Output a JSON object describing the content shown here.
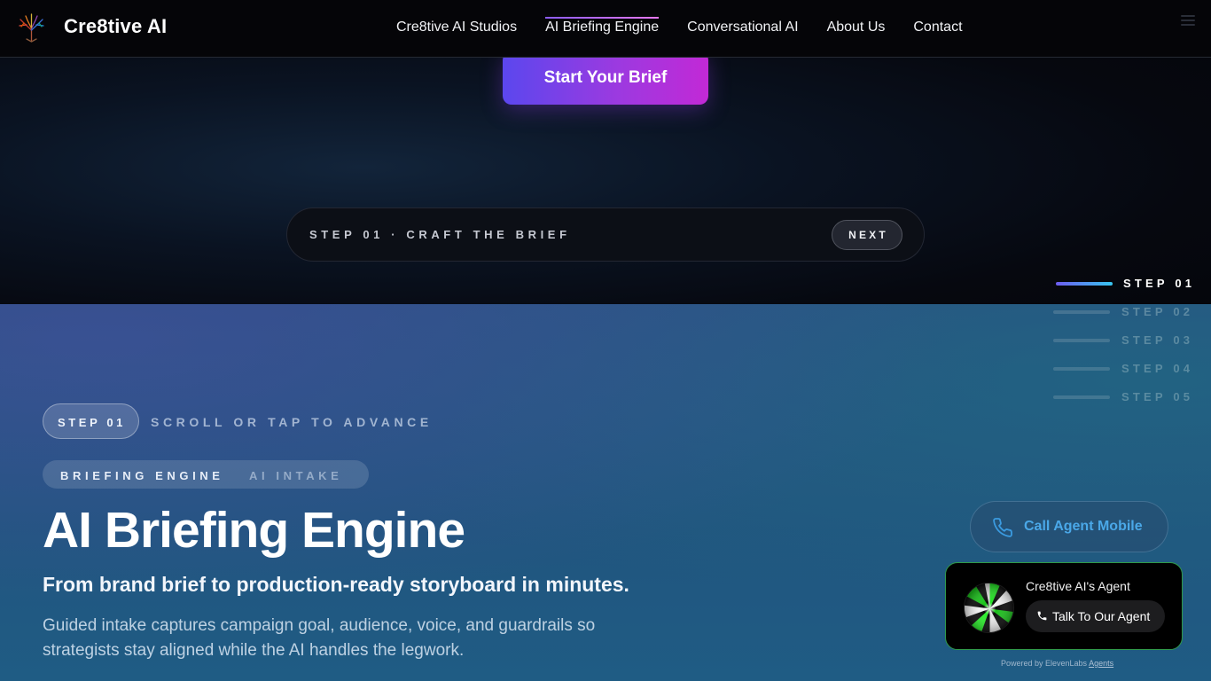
{
  "nav": {
    "brand": "Cre8tive AI",
    "links": [
      "Cre8tive AI Studios",
      "AI Briefing Engine",
      "Conversational AI",
      "About Us",
      "Contact"
    ],
    "active_link": "AI Briefing Engine",
    "menu_icon": "hamburger-icon"
  },
  "hero": {
    "cta_label": "Start Your Brief",
    "step_bar_label": "STEP 01 · CRAFT THE BRIEF",
    "next_label": "NEXT"
  },
  "step_nav": {
    "items": [
      "STEP 01",
      "STEP 02",
      "STEP 03",
      "STEP 04",
      "STEP 05"
    ],
    "active_index": 0
  },
  "section": {
    "step_pill": "STEP 01",
    "scroll_hint": "SCROLL OR TAP TO ADVANCE",
    "eyebrow_primary": "BRIEFING ENGINE",
    "eyebrow_secondary": "AI INTAKE",
    "title": "AI Briefing Engine",
    "subtitle": "From brand brief to production-ready storyboard in minutes.",
    "body": "Guided intake captures campaign goal, audience, voice, and guardrails so strategists stay aligned while the AI handles the legwork."
  },
  "agent": {
    "call_label": "Call Agent Mobile",
    "call_icon": "phone-icon",
    "agent_name": "Cre8tive AI's Agent",
    "talk_label": "Talk To Our Agent",
    "powered_prefix": "Powered by ElevenLabs",
    "powered_link": "Agents"
  },
  "colors": {
    "accent_gradient_start": "#5b47ee",
    "accent_gradient_end": "#c229d6",
    "call_text": "#4aa8e8",
    "agent_border": "#2f9a4a",
    "orb_green": "#22dd22"
  }
}
